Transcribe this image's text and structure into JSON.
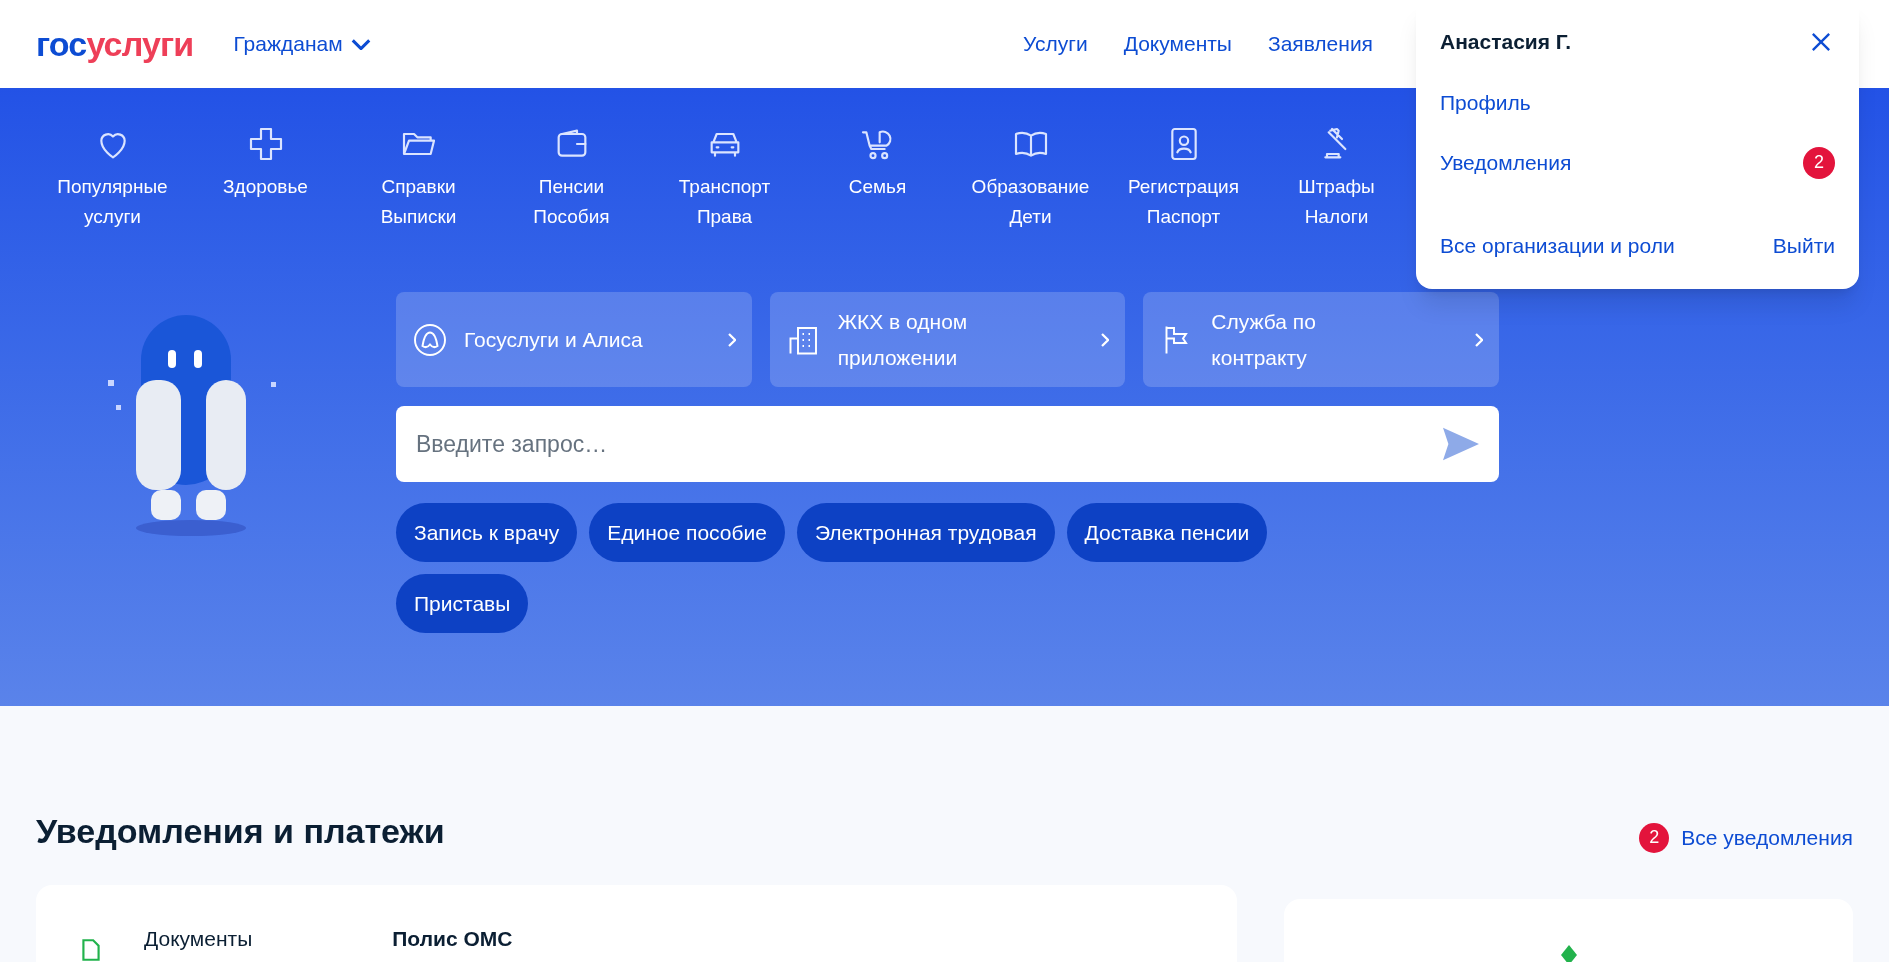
{
  "header": {
    "logo": {
      "part_1": "гос",
      "part_2": "услуги"
    },
    "audience": "Гражданам",
    "nav": [
      "Услуги",
      "Документы",
      "Заявления"
    ]
  },
  "user_menu": {
    "name": "Анастасия Г.",
    "items": [
      {
        "label": "Профиль"
      },
      {
        "label": "Уведомления",
        "badge": "2"
      }
    ],
    "footer": {
      "link": "Все организации и роли",
      "logout": "Выйти"
    }
  },
  "categories": [
    {
      "kind": "heart",
      "lines": [
        "Популярные",
        "услуги"
      ]
    },
    {
      "kind": "cross",
      "lines": [
        "Здоровье"
      ]
    },
    {
      "kind": "folder",
      "lines": [
        "Справки",
        "Выписки"
      ]
    },
    {
      "kind": "wallet",
      "lines": [
        "Пенсии",
        "Пособия"
      ]
    },
    {
      "kind": "car",
      "lines": [
        "Транспорт",
        "Права"
      ]
    },
    {
      "kind": "stroller",
      "lines": [
        "Семья"
      ]
    },
    {
      "kind": "book",
      "lines": [
        "Образование",
        "Дети"
      ]
    },
    {
      "kind": "id",
      "lines": [
        "Регистрация",
        "Паспорт"
      ]
    },
    {
      "kind": "gavel",
      "lines": [
        "Штрафы",
        "Налоги"
      ]
    }
  ],
  "quick_cards": [
    {
      "kind": "alice",
      "label": "Госуслуги и Алиса"
    },
    {
      "kind": "building",
      "label": "ЖКХ в одном приложении"
    },
    {
      "kind": "flag",
      "label": "Служба по контракту"
    }
  ],
  "search": {
    "placeholder": "Введите запрос…"
  },
  "chips": [
    "Запись к врачу",
    "Единое пособие",
    "Электронная трудовая",
    "Доставка пенсии",
    "Приставы"
  ],
  "notifications": {
    "title": "Уведомления и платежи",
    "count": "2",
    "all_link": "Все уведомления",
    "card": {
      "category": "Документы",
      "title": "Полис ОМС"
    }
  }
}
